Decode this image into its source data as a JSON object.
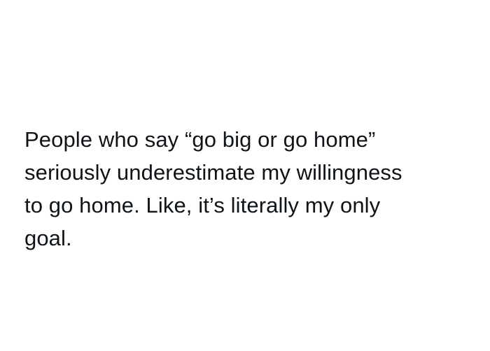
{
  "post": {
    "lines": [
      "People who say “go big or go home”",
      "seriously underestimate my willingness",
      "to go home. Like, it’s literally my only",
      "goal."
    ]
  }
}
